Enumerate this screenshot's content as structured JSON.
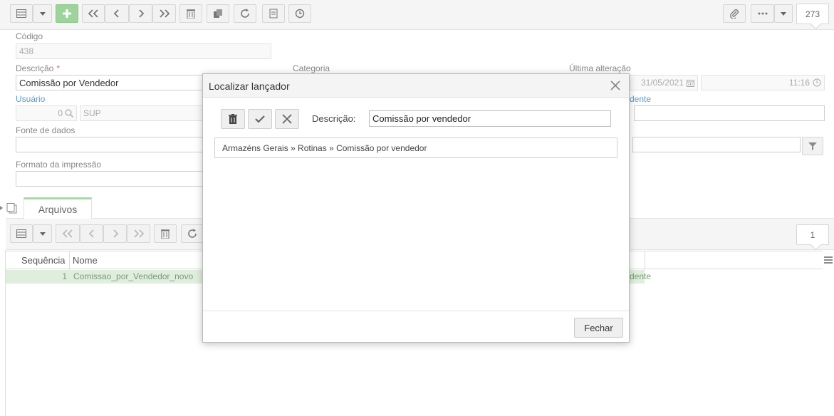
{
  "toolbar": {
    "record_count": "273"
  },
  "form": {
    "codigo_label": "Código",
    "codigo_value": "438",
    "descricao_label": "Descrição",
    "descricao_required": "*",
    "descricao_value": "Comissão por Vendedor",
    "categoria_label": "Categoria",
    "ultima_alteracao_label": "Última alteração",
    "ultima_alteracao_date": "31/05/2021",
    "ultima_alteracao_time": "11:16",
    "usuario_label": "Usuário",
    "usuario_id": "0",
    "usuario_name": "SUP",
    "dependente_label_partial": "dente",
    "fonte_label": "Fonte de dados",
    "formato_label": "Formato da impressão"
  },
  "tabs": [
    {
      "label": "Arquivos"
    }
  ],
  "sub_toolbar": {
    "record_count": "1"
  },
  "grid": {
    "columns": [
      "Sequência",
      "Nome"
    ],
    "rows": [
      {
        "sequencia": "1",
        "nome": "Comissao_por_Vendedor_novo"
      }
    ],
    "row_trailing_partial": "dente"
  },
  "modal": {
    "title": "Localizar lançador",
    "search_label": "Descrição:",
    "search_value": "Comissão por vendedor",
    "result": "Armazéns Gerais » Rotinas » Comissão por vendedor",
    "close_button": "Fechar"
  },
  "colors": {
    "accent_green": "#9ed39b",
    "link_blue": "#5b9bd5",
    "required_red": "#e06c6c"
  }
}
